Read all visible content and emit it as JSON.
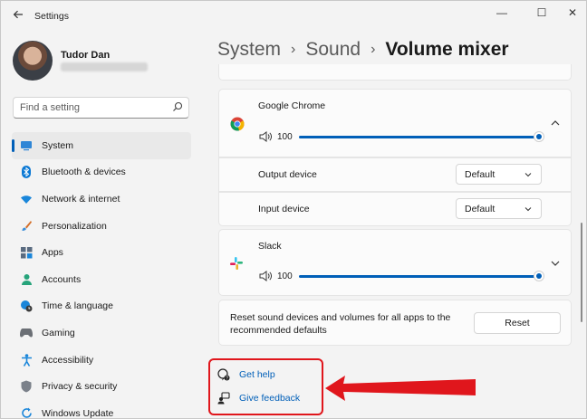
{
  "window": {
    "app_title": "Settings",
    "back_icon": "arrow-left-icon",
    "controls": {
      "minimize": "—",
      "maximize": "☐",
      "close": "✕"
    }
  },
  "profile": {
    "name": "Tudor Dan",
    "email_obscured": true
  },
  "search": {
    "placeholder": "Find a setting",
    "value": ""
  },
  "nav": {
    "items": [
      {
        "label": "System",
        "icon": "monitor-icon",
        "active": true
      },
      {
        "label": "Bluetooth & devices",
        "icon": "bluetooth-icon"
      },
      {
        "label": "Network & internet",
        "icon": "wifi-icon"
      },
      {
        "label": "Personalization",
        "icon": "brush-icon"
      },
      {
        "label": "Apps",
        "icon": "apps-icon"
      },
      {
        "label": "Accounts",
        "icon": "person-icon"
      },
      {
        "label": "Time & language",
        "icon": "clock-globe-icon"
      },
      {
        "label": "Gaming",
        "icon": "gamepad-icon"
      },
      {
        "label": "Accessibility",
        "icon": "accessibility-icon"
      },
      {
        "label": "Privacy & security",
        "icon": "shield-icon"
      },
      {
        "label": "Windows Update",
        "icon": "update-icon"
      }
    ]
  },
  "breadcrumb": {
    "level1": "System",
    "level2": "Sound",
    "current": "Volume mixer",
    "separator": "›"
  },
  "apps": {
    "chrome": {
      "name": "Google Chrome",
      "volume": "100",
      "volume_fraction": 1.0,
      "expanded": true,
      "output_device_label": "Output device",
      "output_device_value": "Default",
      "input_device_label": "Input device",
      "input_device_value": "Default"
    },
    "slack": {
      "name": "Slack",
      "volume": "100",
      "volume_fraction": 1.0,
      "expanded": false
    }
  },
  "reset": {
    "text": "Reset sound devices and volumes for all apps to the recommended defaults",
    "button_label": "Reset"
  },
  "help": {
    "get_help": "Get help",
    "give_feedback": "Give feedback"
  },
  "colors": {
    "accent": "#005fb8",
    "highlight": "#e0161c",
    "background": "#f3f3f3",
    "card": "#fbfbfb"
  }
}
